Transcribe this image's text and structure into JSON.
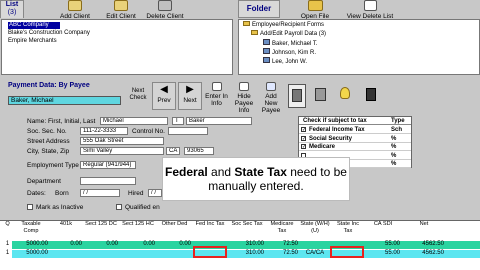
{
  "client_list": {
    "tab": "List",
    "count": "(3)",
    "items": [
      "ABC Company",
      "Blake's Construction Company",
      "Empire Merchants"
    ]
  },
  "toolbar": {
    "add_client": "Add Client",
    "edit_client": "Edit Client",
    "delete_client": "Delete Client"
  },
  "folder": {
    "tab": "Folder",
    "open_file": "Open File",
    "view_delete": "View Delete List"
  },
  "tree": {
    "root": "Employee/Recipient Forms",
    "node": "Add/Edit Payroll Data (3)",
    "leaves": [
      "Baker, Michael T.",
      "Johnson, Kim R.",
      "Lee, John W."
    ]
  },
  "payment": {
    "title": "Payment Data: By Payee",
    "payee": "Baker, Michael"
  },
  "nav": {
    "next_check": "Next Check",
    "prev": "Prev",
    "next": "Next",
    "enter_info": "Enter In Info",
    "hide_payee": "Hide Payee Info",
    "add_new": "Add New Payee"
  },
  "form": {
    "name_label": "Name: First, Initial, Last",
    "first": "Michael",
    "initial": "T",
    "last": "Baker",
    "ssn_label": "Soc. Sec. No.",
    "ssn": "111-22-3333",
    "control_label": "Control No.",
    "street_label": "Street Address",
    "street": "555 Oak Street",
    "city_label": "City, State, Zip",
    "city": "Simi Valley",
    "state": "CA",
    "zip": "93065",
    "emp_type_label": "Employment Type",
    "emp_type": "Regular (941/944)",
    "dept_label": "Department",
    "dates_label": "Dates:",
    "born_label": "Born",
    "born": "/ /",
    "hired_label": "Hired",
    "hired": "/ /",
    "mark_inactive": "Mark as Inactive",
    "qualified": "Qualified en"
  },
  "tax_table": {
    "head_check": "Check if subject to tax",
    "head_type": "Type",
    "rows": [
      {
        "name": "Federal Income Tax",
        "type": "Sch",
        "checked": true
      },
      {
        "name": "Social Security",
        "type": "%",
        "checked": true
      },
      {
        "name": "Medicare",
        "type": "%",
        "checked": true
      },
      {
        "name": "",
        "type": "%",
        "checked": false
      },
      {
        "name": "",
        "type": "%",
        "checked": false
      }
    ]
  },
  "overlay": {
    "part1": "Federal",
    "part2": " and ",
    "part3": "State Tax",
    "part4": " need to be manually entered."
  },
  "grid": {
    "headers": [
      "Q",
      "Taxable Comp",
      "401k",
      "Sect 125 DC",
      "Sect 125 HC",
      "Other Ded",
      "Fed Inc Tax",
      "Soc Sec Tax",
      "Medicare Tax",
      "State (W/H)(U)",
      "State Inc Tax",
      "CA SDI",
      "Net"
    ],
    "rows": [
      [
        "1",
        "5000.00",
        "0.00",
        "0.00",
        "0.00",
        "0.00",
        "",
        "310.00",
        "72.50",
        "",
        "",
        "55.00",
        "4562.50"
      ],
      [
        "1",
        "5000.00",
        "",
        "",
        "",
        "",
        "",
        "310.00",
        "72.50",
        "CA/CA",
        "",
        "55.00",
        "4562.50"
      ]
    ]
  }
}
